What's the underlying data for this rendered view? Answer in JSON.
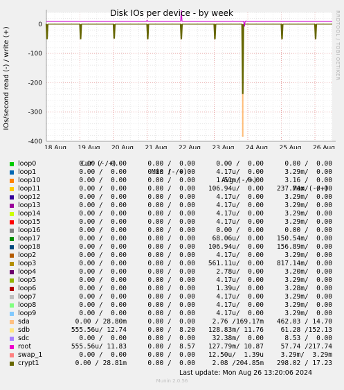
{
  "chart_data": {
    "type": "line",
    "title": "Disk IOs per device - by week",
    "ylabel": "IOs/second read (-) / write (+)",
    "ylim": [
      -400,
      40
    ],
    "yticks": [
      0,
      -100,
      -200,
      -300,
      -400
    ],
    "xticks": [
      "18 Aug",
      "19 Aug",
      "20 Aug",
      "21 Aug",
      "22 Aug",
      "23 Aug",
      "24 Aug",
      "25 Aug",
      "26 Aug"
    ],
    "watermark": "RRDTOOL / TOBI OETIKER",
    "series": [
      {
        "name": "root",
        "color": "#cc00cc",
        "baseline": 10,
        "spikes": [
          [
            4.02,
            47
          ],
          [
            5.55,
            10.8
          ],
          [
            5.95,
            11
          ],
          [
            3.0,
            13
          ],
          [
            5.9,
            -8
          ]
        ]
      },
      {
        "name": "crypt1",
        "color": "#666600",
        "baseline": 0,
        "read_dips": [
          [
            0.02,
            -50
          ],
          [
            1.02,
            -50
          ],
          [
            2.02,
            -48
          ],
          [
            3.02,
            -50
          ],
          [
            4.02,
            -50
          ],
          [
            5.02,
            -50
          ],
          [
            5.85,
            -237
          ],
          [
            7.02,
            -50
          ],
          [
            8.02,
            -50
          ]
        ]
      },
      {
        "name": "sda",
        "color": "#ffbb77",
        "read_dips": [
          [
            5.85,
            -385
          ]
        ]
      }
    ]
  },
  "legend": {
    "headers": [
      "Cur (-/+)",
      "Min (-/+)",
      "Avg (-/+)",
      "Max (-/+)"
    ],
    "rows": [
      {
        "name": "loop0",
        "color": "#00cc00",
        "cur": "0.00 /  0.00",
        "min": "0.00 /  0.00",
        "avg": "0.00 /  0.00",
        "max": "0.00 /  0.00"
      },
      {
        "name": "loop1",
        "color": "#0066b3",
        "cur": "0.00 /  0.00",
        "min": "0.00 /  0.00",
        "avg": "4.17u/  0.00",
        "max": "3.29m/  0.00"
      },
      {
        "name": "loop10",
        "color": "#ff8000",
        "cur": "0.00 /  0.00",
        "min": "0.00 /  0.00",
        "avg": "1.51m/  0.00",
        "max": "3.16 /  0.00"
      },
      {
        "name": "loop11",
        "color": "#ffcc00",
        "cur": "0.00 /  0.00",
        "min": "0.00 /  0.00",
        "avg": "106.94u/  0.00",
        "max": "237.74m/  0.00"
      },
      {
        "name": "loop12",
        "color": "#330099",
        "cur": "0.00 /  0.00",
        "min": "0.00 /  0.00",
        "avg": "4.17u/  0.00",
        "max": "3.29m/  0.00"
      },
      {
        "name": "loop13",
        "color": "#990099",
        "cur": "0.00 /  0.00",
        "min": "0.00 /  0.00",
        "avg": "4.17u/  0.00",
        "max": "3.29m/  0.00"
      },
      {
        "name": "loop14",
        "color": "#ccff00",
        "cur": "0.00 /  0.00",
        "min": "0.00 /  0.00",
        "avg": "4.17u/  0.00",
        "max": "3.29m/  0.00"
      },
      {
        "name": "loop15",
        "color": "#ff0000",
        "cur": "0.00 /  0.00",
        "min": "0.00 /  0.00",
        "avg": "4.17u/  0.00",
        "max": "3.29m/  0.00"
      },
      {
        "name": "loop16",
        "color": "#808080",
        "cur": "0.00 /  0.00",
        "min": "0.00 /  0.00",
        "avg": "0.00 /  0.00",
        "max": "0.00 /  0.00"
      },
      {
        "name": "loop17",
        "color": "#008f00",
        "cur": "0.00 /  0.00",
        "min": "0.00 /  0.00",
        "avg": "68.06u/  0.00",
        "max": "150.54m/  0.00"
      },
      {
        "name": "loop18",
        "color": "#00487d",
        "cur": "0.00 /  0.00",
        "min": "0.00 /  0.00",
        "avg": "106.94u/  0.00",
        "max": "156.89m/  0.00"
      },
      {
        "name": "loop2",
        "color": "#b35a00",
        "cur": "0.00 /  0.00",
        "min": "0.00 /  0.00",
        "avg": "4.17u/  0.00",
        "max": "3.29m/  0.00"
      },
      {
        "name": "loop3",
        "color": "#b38f00",
        "cur": "0.00 /  0.00",
        "min": "0.00 /  0.00",
        "avg": "561.11u/  0.00",
        "max": "817.14m/  0.00"
      },
      {
        "name": "loop4",
        "color": "#6b006b",
        "cur": "0.00 /  0.00",
        "min": "0.00 /  0.00",
        "avg": "2.78u/  0.00",
        "max": "3.20m/  0.00"
      },
      {
        "name": "loop5",
        "color": "#8fb300",
        "cur": "0.00 /  0.00",
        "min": "0.00 /  0.00",
        "avg": "4.17u/  0.00",
        "max": "3.29m/  0.00"
      },
      {
        "name": "loop6",
        "color": "#b30000",
        "cur": "0.00 /  0.00",
        "min": "0.00 /  0.00",
        "avg": "1.39u/  0.00",
        "max": "3.28m/  0.00"
      },
      {
        "name": "loop7",
        "color": "#bebebe",
        "cur": "0.00 /  0.00",
        "min": "0.00 /  0.00",
        "avg": "4.17u/  0.00",
        "max": "3.29m/  0.00"
      },
      {
        "name": "loop8",
        "color": "#80ff80",
        "cur": "0.00 /  0.00",
        "min": "0.00 /  0.00",
        "avg": "4.17u/  0.00",
        "max": "3.29m/  0.00"
      },
      {
        "name": "loop9",
        "color": "#80c9ff",
        "cur": "0.00 /  0.00",
        "min": "0.00 /  0.00",
        "avg": "4.17u/  0.00",
        "max": "3.29m/  0.00"
      },
      {
        "name": "sda",
        "color": "#ffc080",
        "cur": "0.00 / 28.80m",
        "min": "0.00 /  0.00",
        "avg": "2.76 /169.17m",
        "max": "462.03 / 14.70"
      },
      {
        "name": "sdb",
        "color": "#ffe680",
        "cur": "555.56u/ 12.74",
        "min": "0.00 /  8.20",
        "avg": "128.83m/ 11.76",
        "max": "61.28 /152.13"
      },
      {
        "name": "sdc",
        "color": "#aa80ff",
        "cur": "0.00 /  0.00",
        "min": "0.00 /  0.00",
        "avg": "32.38m/  0.00",
        "max": "8.53 /  0.00"
      },
      {
        "name": "root",
        "color": "#ee00cc",
        "cur": "555.56u/ 11.83",
        "min": "0.00 /  8.57",
        "avg": "127.79m/ 10.87",
        "max": "57.74 /217.74"
      },
      {
        "name": "swap_1",
        "color": "#ff8080",
        "cur": "0.00 /  0.00",
        "min": "0.00 /  0.00",
        "avg": "12.50u/  1.39u",
        "max": "3.29m/  3.29m"
      },
      {
        "name": "crypt1",
        "color": "#666600",
        "cur": "0.00 / 28.81m",
        "min": "0.00 /  0.00",
        "avg": "2.08 /204.85m",
        "max": "298.02 / 17.23"
      }
    ]
  },
  "last_update": "Last update: Mon Aug 26 13:20:06 2024",
  "footer": "Munin 2.0.56"
}
